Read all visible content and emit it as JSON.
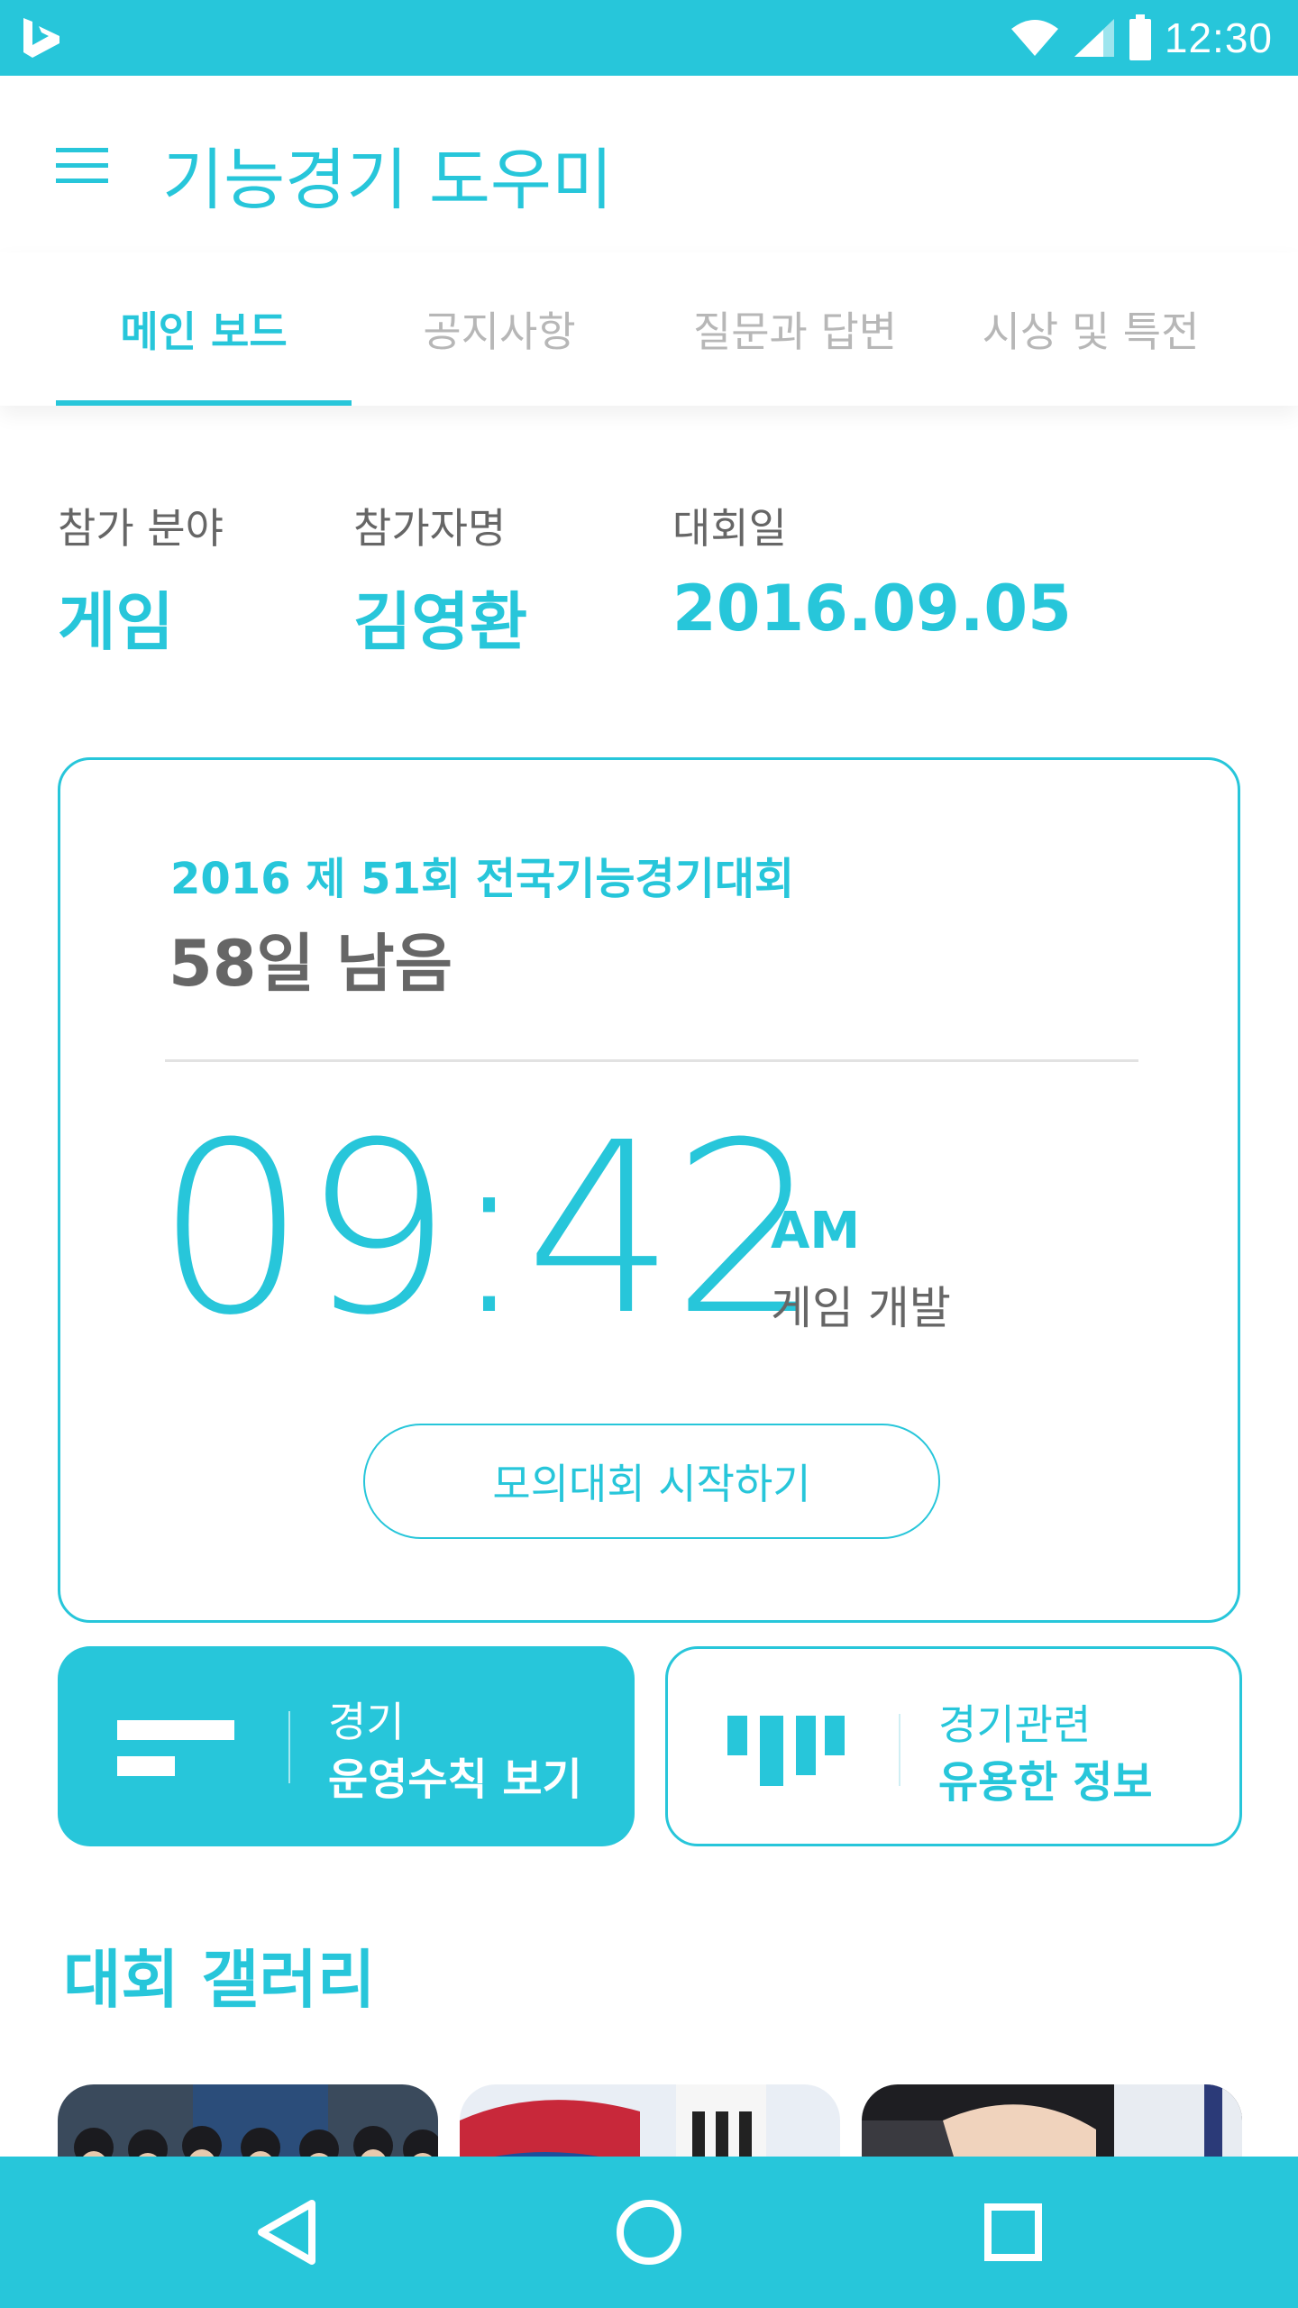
{
  "status_bar": {
    "time": "12:30",
    "logo": "bing-logo-icon"
  },
  "app_bar": {
    "title": "기능경기 도우미",
    "menu_icon": "hamburger-menu-icon"
  },
  "tabs": [
    {
      "label": "메인 보드",
      "active": true
    },
    {
      "label": "공지사항",
      "active": false
    },
    {
      "label": "질문과 답변",
      "active": false
    },
    {
      "label": "시상 및 특전",
      "active": false
    }
  ],
  "info": {
    "field": {
      "label": "참가 분야",
      "value": "게임"
    },
    "participant": {
      "label": "참가자명",
      "value": "김영환"
    },
    "date": {
      "label": "대회일",
      "value": "2016.09.05"
    }
  },
  "countdown": {
    "event_title": "2016 제 51회 전국기능경기대회",
    "days_left": "58일 남음",
    "time": "09:42",
    "ampm": "AM",
    "category": "게임 개발",
    "start_button": "모의대회 시작하기"
  },
  "actions": {
    "rules": {
      "top": "경기",
      "bottom": "운영수칙 보기",
      "icon": "document-lines-icon"
    },
    "info": {
      "top": "경기관련",
      "bottom": "유용한 정보",
      "icon": "bar-graph-icon"
    }
  },
  "gallery": {
    "title": "대회 갤러리",
    "images": [
      "team-photo",
      "flag-photo",
      "keyboard-photo"
    ]
  },
  "colors": {
    "accent": "#27c6da",
    "text": "#666666",
    "tab_inactive": "#b7b7b7"
  },
  "nav": {
    "back": "back-triangle-icon",
    "home": "home-circle-icon",
    "recents": "recents-square-icon"
  }
}
